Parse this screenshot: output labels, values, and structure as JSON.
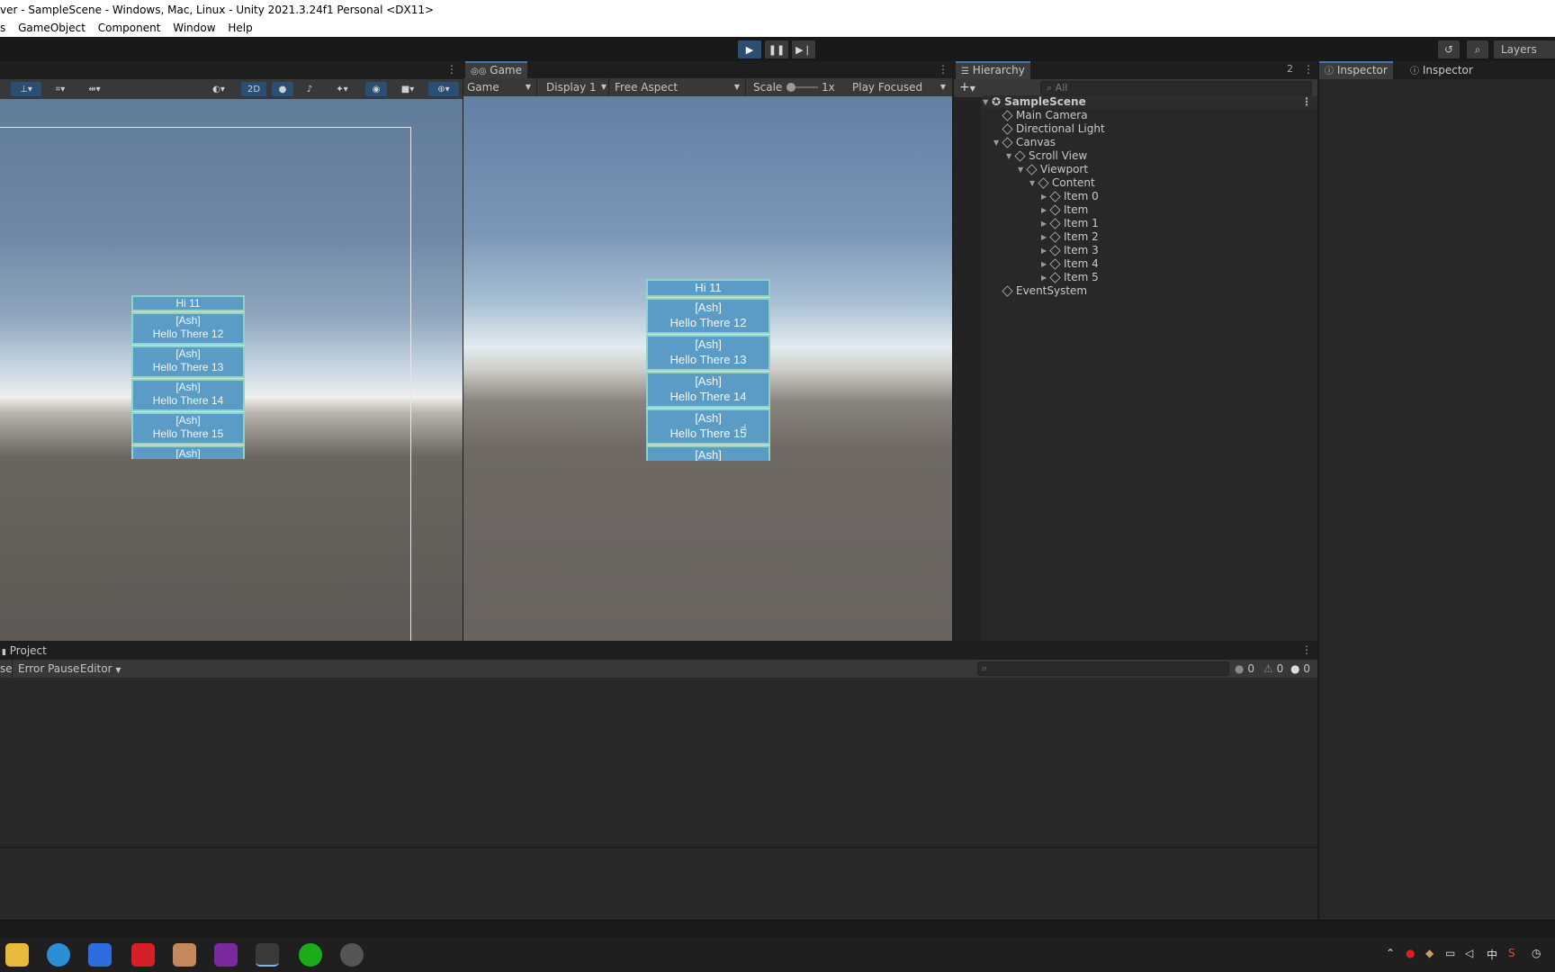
{
  "window": {
    "title": "ver - SampleScene - Windows, Mac, Linux - Unity 2021.3.24f1 Personal <DX11>"
  },
  "menu": [
    "s",
    "GameObject",
    "Component",
    "Window",
    "Help"
  ],
  "toolbar": {
    "play_icon": "play-icon",
    "pause_icon": "pause-icon",
    "step_icon": "step-icon",
    "layers_label": "Layers"
  },
  "scene": {
    "mode_2d_label": "2D",
    "items": [
      {
        "line1": "Hi 11",
        "line2": ""
      },
      {
        "line1": "[Ash]",
        "line2": "Hello There 12"
      },
      {
        "line1": "[Ash]",
        "line2": "Hello There 13"
      },
      {
        "line1": "[Ash]",
        "line2": "Hello There 14"
      },
      {
        "line1": "[Ash]",
        "line2": "Hello There 15"
      },
      {
        "line1": "[Ash]",
        "line2": ""
      }
    ]
  },
  "game": {
    "tab_label": "Game",
    "mode_select": "Game",
    "display_select": "Display 1",
    "aspect_select": "Free Aspect",
    "scale_label": "Scale",
    "scale_value": "1x",
    "play_focus_select": "Play Focused",
    "items": [
      {
        "line1": "Hi 11",
        "line2": ""
      },
      {
        "line1": "[Ash]",
        "line2": "Hello There 12"
      },
      {
        "line1": "[Ash]",
        "line2": "Hello There 13"
      },
      {
        "line1": "[Ash]",
        "line2": "Hello There 14"
      },
      {
        "line1": "[Ash]",
        "line2": "Hello There 15"
      },
      {
        "line1": "[Ash]",
        "line2": ""
      }
    ]
  },
  "hierarchy": {
    "tab_label": "Hierarchy",
    "lock_count": "2",
    "search_placeholder": "All",
    "scene_name": "SampleScene",
    "nodes": [
      {
        "label": "Main Camera",
        "depth": 1,
        "expandable": false
      },
      {
        "label": "Directional Light",
        "depth": 1,
        "expandable": false
      },
      {
        "label": "Canvas",
        "depth": 1,
        "expandable": true
      },
      {
        "label": "Scroll View",
        "depth": 2,
        "expandable": true
      },
      {
        "label": "Viewport",
        "depth": 3,
        "expandable": true
      },
      {
        "label": "Content",
        "depth": 4,
        "expandable": true
      },
      {
        "label": "Item 0",
        "depth": 5,
        "expandable": true
      },
      {
        "label": "Item",
        "depth": 5,
        "expandable": true
      },
      {
        "label": "Item 1",
        "depth": 5,
        "expandable": true
      },
      {
        "label": "Item 2",
        "depth": 5,
        "expandable": true
      },
      {
        "label": "Item 3",
        "depth": 5,
        "expandable": true
      },
      {
        "label": "Item 4",
        "depth": 5,
        "expandable": true
      },
      {
        "label": "Item 5",
        "depth": 5,
        "expandable": true
      },
      {
        "label": "EventSystem",
        "depth": 1,
        "expandable": false
      }
    ]
  },
  "inspector": {
    "tabs": [
      "Inspector",
      "Inspector"
    ]
  },
  "console": {
    "project_tab": "Project",
    "clear_frag": "se",
    "error_pause": "Error Pause",
    "editor_select": "Editor",
    "log_count": "0",
    "warn_count": "0",
    "error_count": "0"
  },
  "colors": {
    "accent": "#3a79bb",
    "item_bg": "#5b9cc6",
    "item_border": "#8fd3c8"
  }
}
